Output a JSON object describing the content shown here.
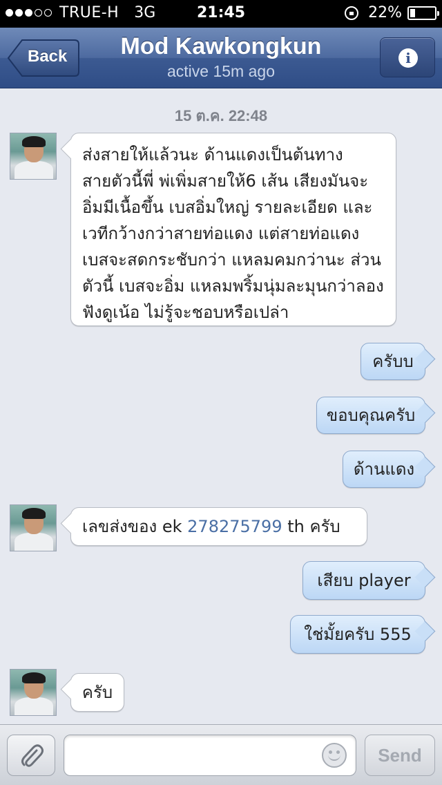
{
  "status_bar": {
    "carrier": "TRUE-H",
    "network": "3G",
    "time": "21:45",
    "battery": "22%",
    "battery_level": 0.22,
    "signal_bars": 3,
    "signal_total": 5
  },
  "nav": {
    "back_label": "Back",
    "title": "Mod Kawkongkun",
    "subtitle": "active 15m ago",
    "info_icon": "i"
  },
  "chat": {
    "timestamp": "15 ต.ค. 22:48",
    "messages": [
      {
        "direction": "in",
        "lines": [
          "ส่งสายให้แล้วนะ ด้านแดงเป็นต้นทาง",
          "สายตัวนี้พี่ พ่เพิ่มสายให้6 เส้น เสียงมันจะ",
          "อิ่มมีเนื้อขึ้น เบสอิ่มใหญ่ รายละเอียด และ",
          "เวทีกว้างกว่าสายท่อแดง แต่สายท่อแดง",
          "เบสจะสดกระชับกว่า แหลมคมกว่านะ ส่วน",
          "ตัวนี้ เบสจะอิ่ม แหลมพริ้มนุ่มละมุนกว่าลอง",
          "ฟังดูเน้อ ไม่รู้จะชอบหรือเปล่า"
        ]
      },
      {
        "direction": "out",
        "text": "ครับบ"
      },
      {
        "direction": "out",
        "text": "ขอบคุณครับ"
      },
      {
        "direction": "out",
        "text": "ด้านแดง"
      },
      {
        "direction": "in",
        "prefix": "เลขส่งของ  ek ",
        "number": "278275799",
        "suffix": " th ครับ"
      },
      {
        "direction": "out",
        "text": "เสียบ player"
      },
      {
        "direction": "out",
        "text": "ใช่มั้ยครับ 555"
      },
      {
        "direction": "in",
        "text": "ครับ"
      }
    ]
  },
  "input_bar": {
    "attach_icon": "paperclip-icon",
    "message_value": "",
    "emoji_icon": "smiley-icon",
    "send_label": "Send"
  },
  "colors": {
    "nav_bar": "#3c5a92",
    "background": "#e6e9f0",
    "outgoing_bubble": "#c9dff7",
    "incoming_bubble": "#ffffff",
    "link": "#4a6fa5"
  }
}
